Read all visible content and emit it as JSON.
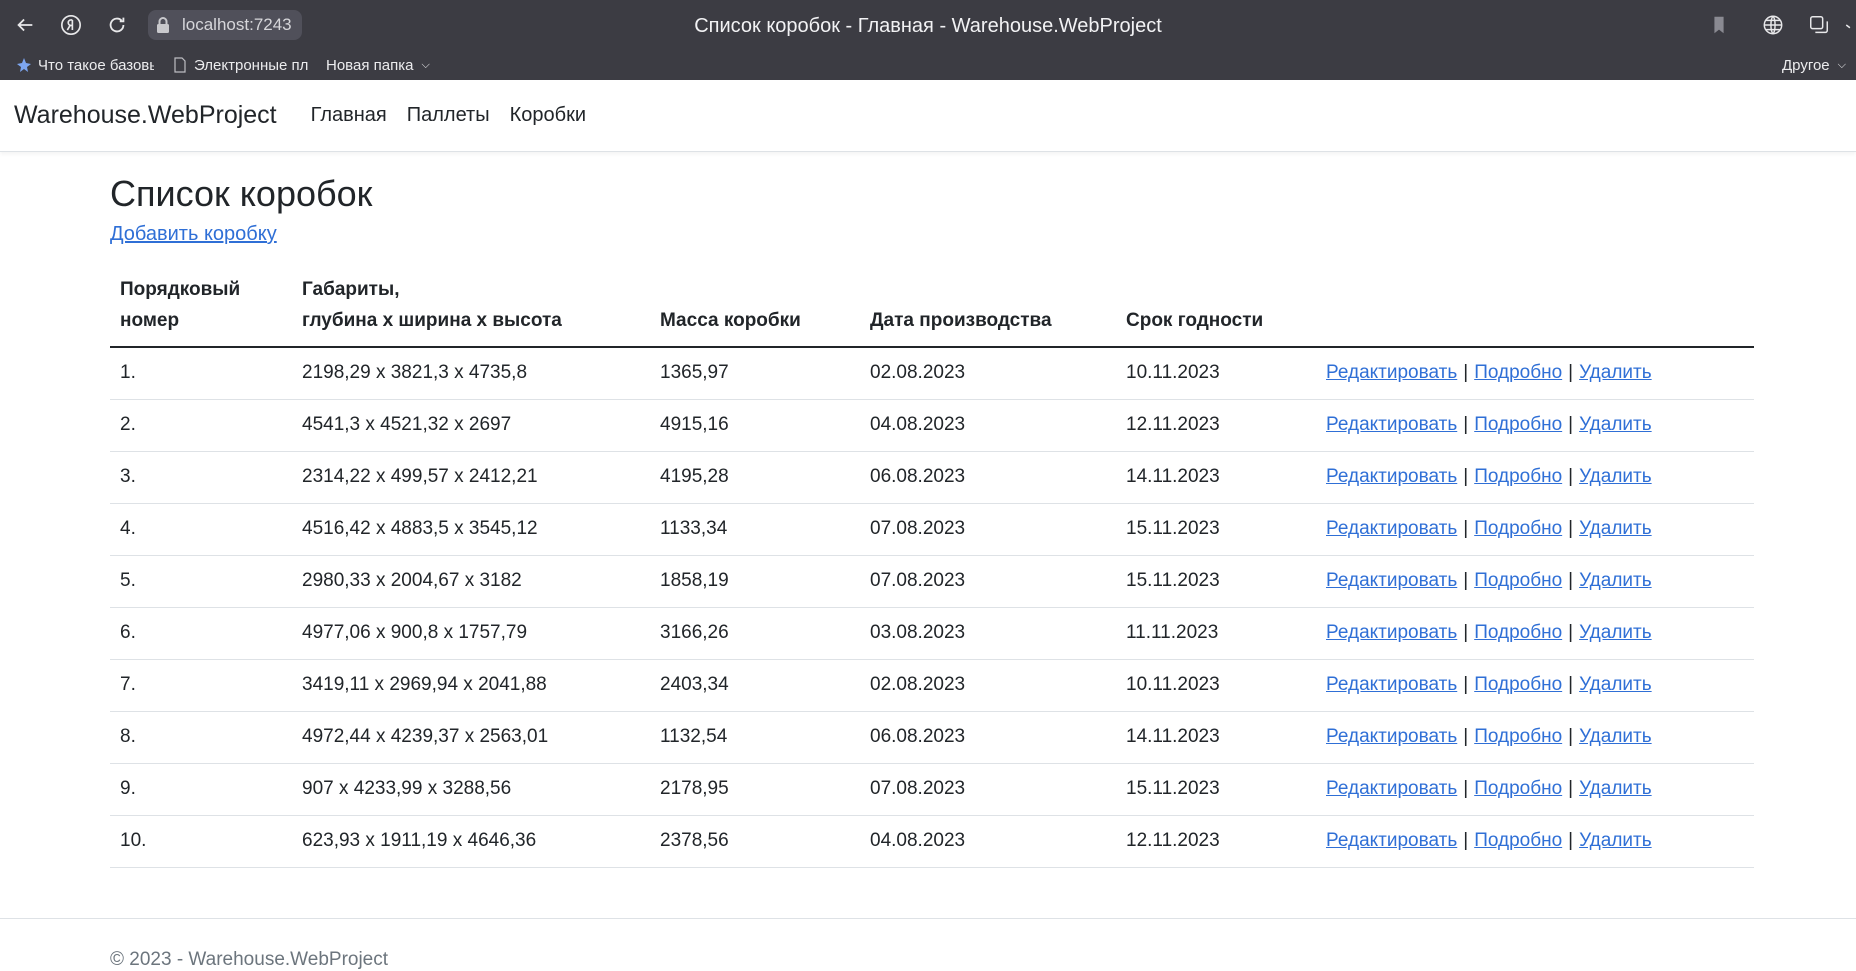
{
  "browser": {
    "url": "localhost:7243",
    "tab_title": "Список коробок - Главная - Warehouse.WebProject",
    "bookmarks": [
      {
        "label": "Что такое базовы"
      },
      {
        "label": "Электронные плат"
      },
      {
        "label": "Новая папка"
      }
    ],
    "other_bookmarks": "Другое"
  },
  "navbar": {
    "brand": "Warehouse.WebProject",
    "links": [
      "Главная",
      "Паллеты",
      "Коробки"
    ]
  },
  "page": {
    "title": "Список коробок",
    "add_link": "Добавить коробку"
  },
  "table": {
    "headers": {
      "number_line1": "Порядковый",
      "number_line2": "номер",
      "dims_line1": "Габариты,",
      "dims_line2": "глубина х ширина х высота",
      "mass": "Масса коробки",
      "production_date": "Дата производства",
      "expiry": "Срок годности"
    },
    "action_labels": {
      "edit": "Редактировать",
      "details": "Подробно",
      "delete": "Удалить",
      "separator": "|"
    },
    "rows": [
      {
        "num": "1.",
        "dims": "2198,29 х 3821,3 х 4735,8",
        "mass": "1365,97",
        "prod": "02.08.2023",
        "exp": "10.11.2023"
      },
      {
        "num": "2.",
        "dims": "4541,3 х 4521,32 х 2697",
        "mass": "4915,16",
        "prod": "04.08.2023",
        "exp": "12.11.2023"
      },
      {
        "num": "3.",
        "dims": "2314,22 х 499,57 х 2412,21",
        "mass": "4195,28",
        "prod": "06.08.2023",
        "exp": "14.11.2023"
      },
      {
        "num": "4.",
        "dims": "4516,42 х 4883,5 х 3545,12",
        "mass": "1133,34",
        "prod": "07.08.2023",
        "exp": "15.11.2023"
      },
      {
        "num": "5.",
        "dims": "2980,33 х 2004,67 х 3182",
        "mass": "1858,19",
        "prod": "07.08.2023",
        "exp": "15.11.2023"
      },
      {
        "num": "6.",
        "dims": "4977,06 х 900,8 х 1757,79",
        "mass": "3166,26",
        "prod": "03.08.2023",
        "exp": "11.11.2023"
      },
      {
        "num": "7.",
        "dims": "3419,11 х 2969,94 х 2041,88",
        "mass": "2403,34",
        "prod": "02.08.2023",
        "exp": "10.11.2023"
      },
      {
        "num": "8.",
        "dims": "4972,44 х 4239,37 х 2563,01",
        "mass": "1132,54",
        "prod": "06.08.2023",
        "exp": "14.11.2023"
      },
      {
        "num": "9.",
        "dims": "907 х 4233,99 х 3288,56",
        "mass": "2178,95",
        "prod": "07.08.2023",
        "exp": "15.11.2023"
      },
      {
        "num": "10.",
        "dims": "623,93 х 1911,19 х 4646,36",
        "mass": "2378,56",
        "prod": "04.08.2023",
        "exp": "12.11.2023"
      }
    ]
  },
  "footer": {
    "text": "© 2023 - Warehouse.WebProject"
  },
  "colors": {
    "link": "#2f6fd6",
    "chrome_bg": "#3c3c43",
    "text": "#212529",
    "muted": "#6c757d"
  },
  "icons": [
    "back-arrow-icon",
    "yandex-icon",
    "reload-icon",
    "lock-icon",
    "bookmark-icon",
    "globe-icon",
    "tabs-icon"
  ]
}
